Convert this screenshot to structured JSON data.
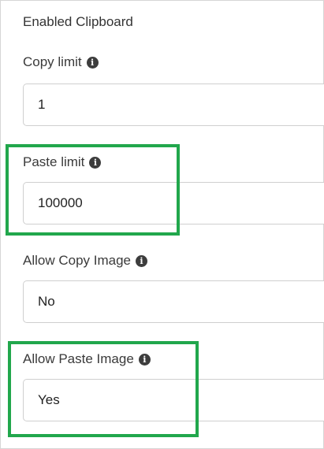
{
  "section": {
    "title": "Enabled Clipboard"
  },
  "fields": {
    "copy_limit": {
      "label": "Copy limit",
      "value": "1",
      "info_icon": "info-circle-icon"
    },
    "paste_limit": {
      "label": "Paste limit",
      "value": "100000",
      "info_icon": "info-circle-icon"
    },
    "allow_copy_image": {
      "label": "Allow Copy Image",
      "value": "No",
      "info_icon": "info-circle-icon"
    },
    "allow_paste_image": {
      "label": "Allow Paste Image",
      "value": "Yes",
      "info_icon": "info-circle-icon"
    }
  },
  "info_glyph": "i",
  "colors": {
    "highlight": "#21a74c",
    "border": "#cfcfcf",
    "text": "#2f2f2f"
  }
}
